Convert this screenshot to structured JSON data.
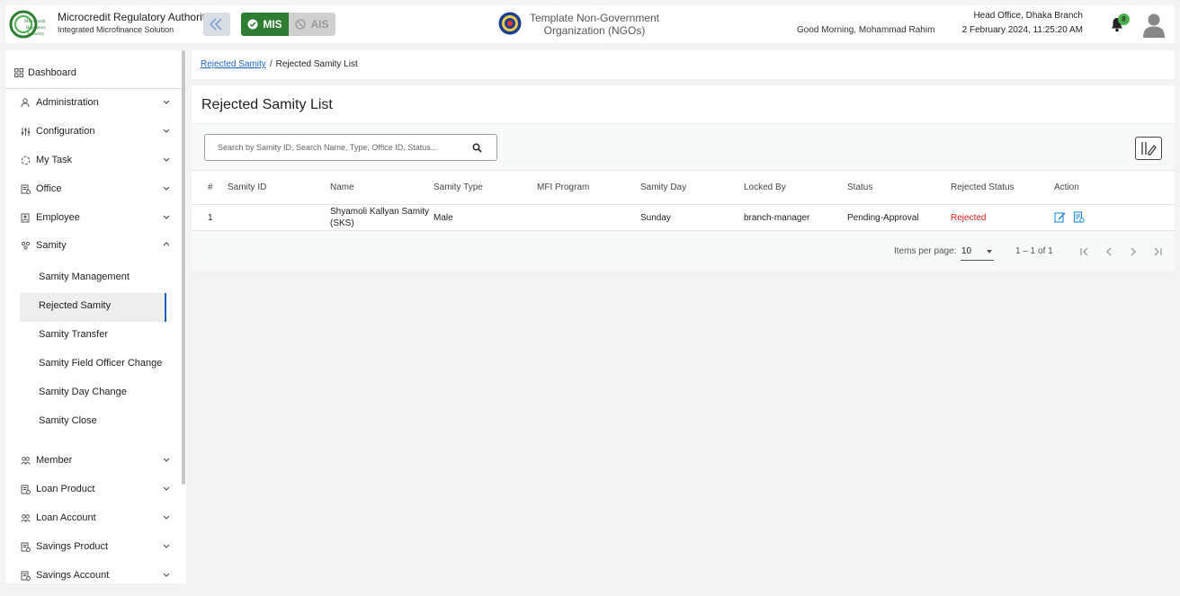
{
  "header": {
    "org_title": "Microcredit Regulatory Authority",
    "org_subtitle": "Integrated Microfinance Solution",
    "logo_text": "Microcredit Regulatory Authority",
    "mis_label": "MIS",
    "ais_label": "AIS",
    "ngo_line1": "Template Non-Government",
    "ngo_line2": "Organization (NGOs)",
    "greeting": "Good Morning, Mohammad Rahim",
    "branch": "Head Office, Dhaka Branch",
    "datetime": "2 February 2024, 11:25:20 AM",
    "notification_count": "8",
    "accent_color": "#2e7d32"
  },
  "sidebar": {
    "dashboard": "Dashboard",
    "items": [
      {
        "label": "Administration",
        "icon": "users-cog-icon"
      },
      {
        "label": "Configuration",
        "icon": "sliders-icon"
      },
      {
        "label": "My Task",
        "icon": "task-circle-icon"
      },
      {
        "label": "Office",
        "icon": "office-doc-icon"
      },
      {
        "label": "Employee",
        "icon": "employee-icon"
      },
      {
        "label": "Samity",
        "icon": "samity-icon"
      }
    ],
    "samity_sub": [
      "Samity Management",
      "Rejected Samity",
      "Samity Transfer",
      "Samity Field Officer Change",
      "Samity Day Change",
      "Samity Close"
    ],
    "items_after": [
      {
        "label": "Member",
        "icon": "member-icon"
      },
      {
        "label": "Loan Product",
        "icon": "loan-product-icon"
      },
      {
        "label": "Loan Account",
        "icon": "loan-account-icon"
      },
      {
        "label": "Savings Product",
        "icon": "savings-product-icon"
      },
      {
        "label": "Savings Account",
        "icon": "savings-account-icon"
      }
    ]
  },
  "breadcrumb": {
    "parent": "Rejected Samity",
    "separator": "/",
    "current": "Rejected Samity List"
  },
  "main": {
    "title": "Rejected Samity List",
    "search_placeholder": "Search by Samity ID, Search Name, Type, Office ID, Status...",
    "columns": [
      "#",
      "Samity ID",
      "Name",
      "Samity Type",
      "MFI Program",
      "Samity Day",
      "Locked By",
      "Status",
      "Rejected Status",
      "Action"
    ],
    "rows": [
      {
        "index": "1",
        "samity_id": "",
        "name": "Shyamoli Kallyan Samity (SKS)",
        "samity_type": "Male",
        "mfi_program": "",
        "samity_day": "Sunday",
        "locked_by": "branch-manager",
        "status": "Pending-Approval",
        "rejected_status": "Rejected"
      }
    ],
    "rejected_color": "#e01b1b",
    "items_per_page_label": "Items per page:",
    "items_per_page": "10",
    "range": "1 – 1 of 1"
  }
}
